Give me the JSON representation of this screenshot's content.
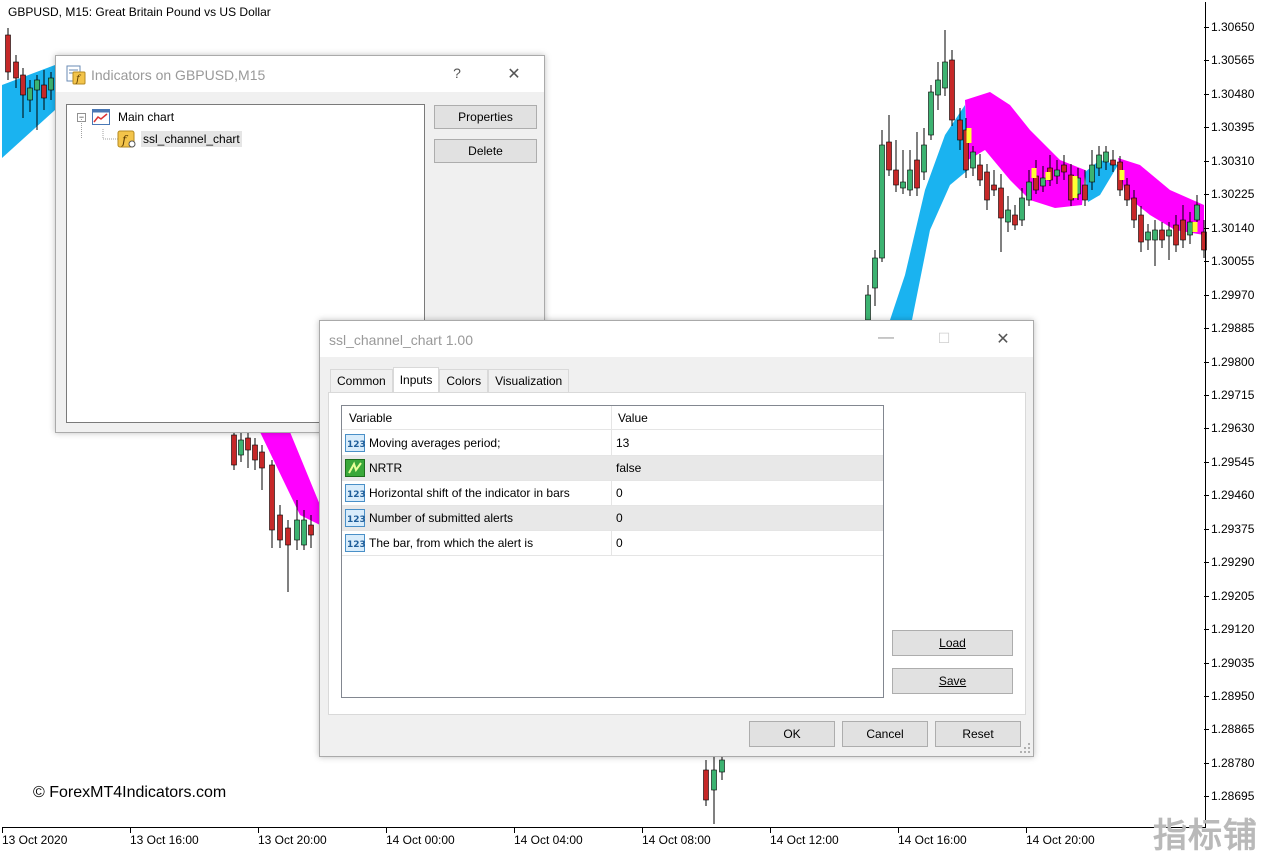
{
  "chart": {
    "title": "GBPUSD, M15:  Great Britain Pound vs US Dollar",
    "watermark": "© ForexMT4Indicators.com",
    "corner_watermark": "指标铺",
    "price_labels": [
      "1.30650",
      "1.30565",
      "1.30480",
      "1.30395",
      "1.30310",
      "1.30225",
      "1.30140",
      "1.30055",
      "1.29970",
      "1.29885",
      "1.29800",
      "1.29715",
      "1.29630",
      "1.29545",
      "1.29460",
      "1.29375",
      "1.29290",
      "1.29205",
      "1.29120",
      "1.29035",
      "1.28950",
      "1.28865",
      "1.28780",
      "1.28695"
    ],
    "time_labels": [
      "13 Oct 2020",
      "13 Oct 16:00",
      "13 Oct 20:00",
      "14 Oct 00:00",
      "14 Oct 04:00",
      "14 Oct 08:00",
      "14 Oct 12:00",
      "14 Oct 16:00",
      "14 Oct 20:00"
    ],
    "colors": {
      "bull": "#3cb371",
      "bear": "#c62828",
      "ssl_up": "#1ab3f0",
      "ssl_down": "#ff00ff",
      "signal": "#ffff33"
    }
  },
  "indicators_window": {
    "title": "Indicators on GBPUSD,M15",
    "help": "?",
    "close": "✕",
    "tree": {
      "root": "Main chart",
      "child": "ssl_channel_chart"
    },
    "properties_button": "Properties",
    "delete_button": "Delete"
  },
  "properties_window": {
    "title": "ssl_channel_chart 1.00",
    "minimize": "—",
    "maximize": "☐",
    "close": "✕",
    "tabs": [
      "Common",
      "Inputs",
      "Colors",
      "Visualization"
    ],
    "active_tab": "Inputs",
    "grid": {
      "headers": {
        "variable": "Variable",
        "value": "Value"
      },
      "rows": [
        {
          "variable": "Moving averages period;",
          "value": "13",
          "icon": "numeric-icon"
        },
        {
          "variable": "NRTR",
          "value": "false",
          "icon": "boolean-icon"
        },
        {
          "variable": "Horizontal shift of the indicator in bars",
          "value": "0",
          "icon": "numeric-icon"
        },
        {
          "variable": "Number of submitted alerts",
          "value": "0",
          "icon": "numeric-icon"
        },
        {
          "variable": "The bar, from which the alert is",
          "value": "0",
          "icon": "numeric-icon"
        }
      ]
    },
    "load_button": "Load",
    "save_button": "Save",
    "ok_button": "OK",
    "cancel_button": "Cancel",
    "reset_button": "Reset"
  }
}
